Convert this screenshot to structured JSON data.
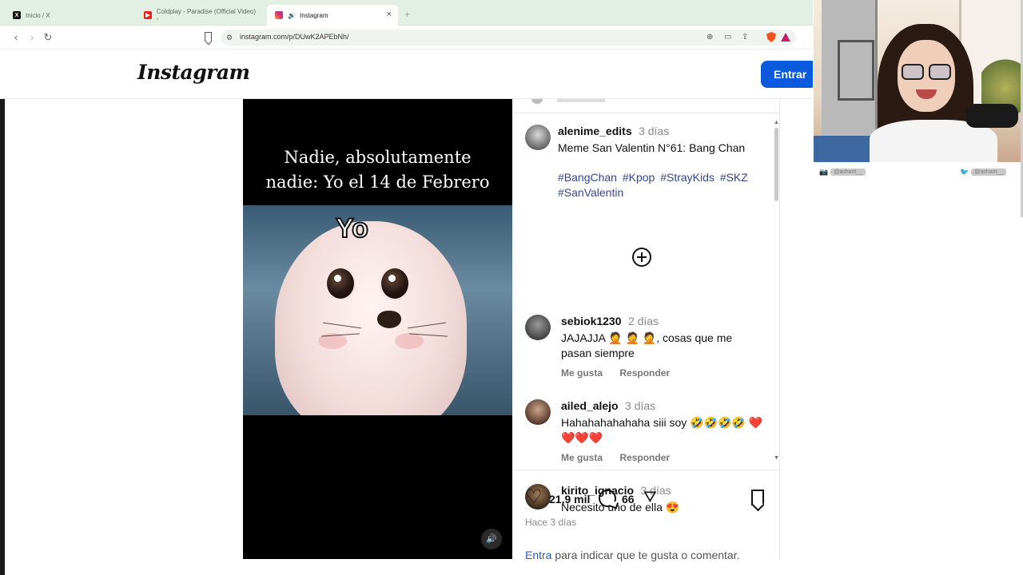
{
  "browser": {
    "tabs": [
      {
        "title": "Inicio / X",
        "favicon": "x-logo-icon"
      },
      {
        "title": "Coldplay - Paradise (Official Video) -",
        "favicon": "youtube-icon"
      },
      {
        "title": "Instagram",
        "favicon": "instagram-icon",
        "active": true,
        "audio": "speaker-icon"
      }
    ],
    "new_tab_symbol": "+",
    "close_symbol": "×",
    "url": "instagram.com/p/DUwK2APEbNh/"
  },
  "instagram": {
    "logo": "Instagram",
    "login_button": "Entrar",
    "post": {
      "image_caption_line1": "Nadie, absolutamente",
      "image_caption_line2": "nadie: Yo el 14 de Febrero",
      "image_label": "Yo",
      "sound_icon": "speaker-icon"
    },
    "caption": {
      "username": "alenime_edits",
      "time": "3 días",
      "text": "Meme San Valentin N°61: Bang Chan",
      "hashtags": [
        "#BangChan",
        "#Kpop",
        "#StrayKids",
        "#SKZ",
        "#SanValentin"
      ]
    },
    "comments": [
      {
        "username": "sebiok1230",
        "time": "2 días",
        "text": "JAJAJJA 🤦 🤦 🤦, cosas que me pasan siempre",
        "like": "Me gusta",
        "reply": "Responder"
      },
      {
        "username": "ailed_alejo",
        "time": "3 días",
        "text": "Hahahahahahaha siii soy 🤣🤣🤣🤣 ❤️❤️❤️❤️",
        "like": "Me gusta",
        "reply": "Responder"
      },
      {
        "username": "kirito_ignacio",
        "time": "3 días",
        "text": "Necesito uno de ella 😍"
      }
    ],
    "stats": {
      "likes": "21,9 mil",
      "comments": "66",
      "date": "Hace 3 días"
    },
    "login_prompt": {
      "link": "Entra",
      "rest": " para indicar que te gusta o comentar."
    }
  },
  "overlay": {
    "social_left": "@asharit__",
    "social_right": "@asharit__"
  },
  "colors": {
    "login_button": "#0a5bdc",
    "hashtag": "#35458f",
    "link": "#2a59a8"
  }
}
